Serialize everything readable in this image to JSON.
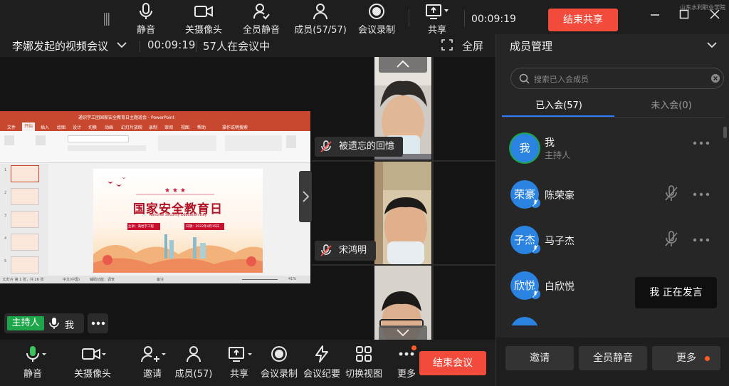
{
  "toolbar": {
    "mute": "静音",
    "camera_off": "关摄像头",
    "mute_all": "全员静音",
    "members": "成员(57/57)",
    "record": "会议录制",
    "share": "共享",
    "timer": "00:09:19",
    "end_share": "结束共享",
    "watermark": "山东水利职业学院"
  },
  "meeting": {
    "title": "李娜发起的视频会议",
    "elapsed": "00:09:19",
    "participants": "57人在会议中",
    "fullscreen": "全屏"
  },
  "presentation": {
    "window_title": "通识学工团国家安全教育日主题班会 - PowerPoint",
    "tabs": [
      "文件",
      "开始",
      "插入",
      "绘图",
      "设计",
      "切换",
      "动画",
      "幻灯片放映",
      "录制",
      "审阅",
      "视图",
      "帮助",
      "操作说明搜索"
    ],
    "slide_title": "国家安全教育日",
    "slide_subtitle": "National Security Education Day",
    "speaker_label": "主讲：满岩字工程",
    "date_label": "日期：2022年4月15日",
    "status_left": "幻灯片 第 1 张，共 26 张",
    "status_lang": "中文(中国)",
    "status_access": "辅助功能：调查",
    "status_notes": "备注",
    "status_zoom": "41%",
    "thumb_numbers": [
      "1",
      "2",
      "3",
      "4",
      "5"
    ]
  },
  "stage": {
    "host_badge": "主持人",
    "host_name": "我"
  },
  "gallery": {
    "tiles": [
      {
        "name": "被遗忘的回憶"
      },
      {
        "name": "宋鸿明"
      },
      {
        "name": ""
      }
    ]
  },
  "bottombar": {
    "mute": "静音",
    "camera_off": "关摄像头",
    "invite": "邀请",
    "members": "成员(57)",
    "share": "共享",
    "record": "会议录制",
    "minutes": "会议纪要",
    "switch_view": "切换视图",
    "more": "更多",
    "end_meeting": "结束会议"
  },
  "sidebar": {
    "title": "成员管理",
    "search_placeholder": "搜索已入会成员",
    "tab_joined": "已入会(57)",
    "tab_not_joined": "未入会(0)",
    "members": [
      {
        "avatar": "我",
        "name": "我",
        "role": "主持人"
      },
      {
        "avatar": "荣豪",
        "name": "陈荣豪",
        "role": ""
      },
      {
        "avatar": "子杰",
        "name": "马子杰",
        "role": ""
      },
      {
        "avatar": "欣悦",
        "name": "白欣悦",
        "role": ""
      }
    ],
    "speaking_tip": "我  正在发言",
    "invite": "邀请",
    "mute_all": "全员静音",
    "more": "更多"
  },
  "colors": {
    "accent_red": "#f24a3b",
    "accent_blue": "#2a83e0",
    "host_green": "#1fa64a",
    "ppt_red": "#c8472f"
  }
}
